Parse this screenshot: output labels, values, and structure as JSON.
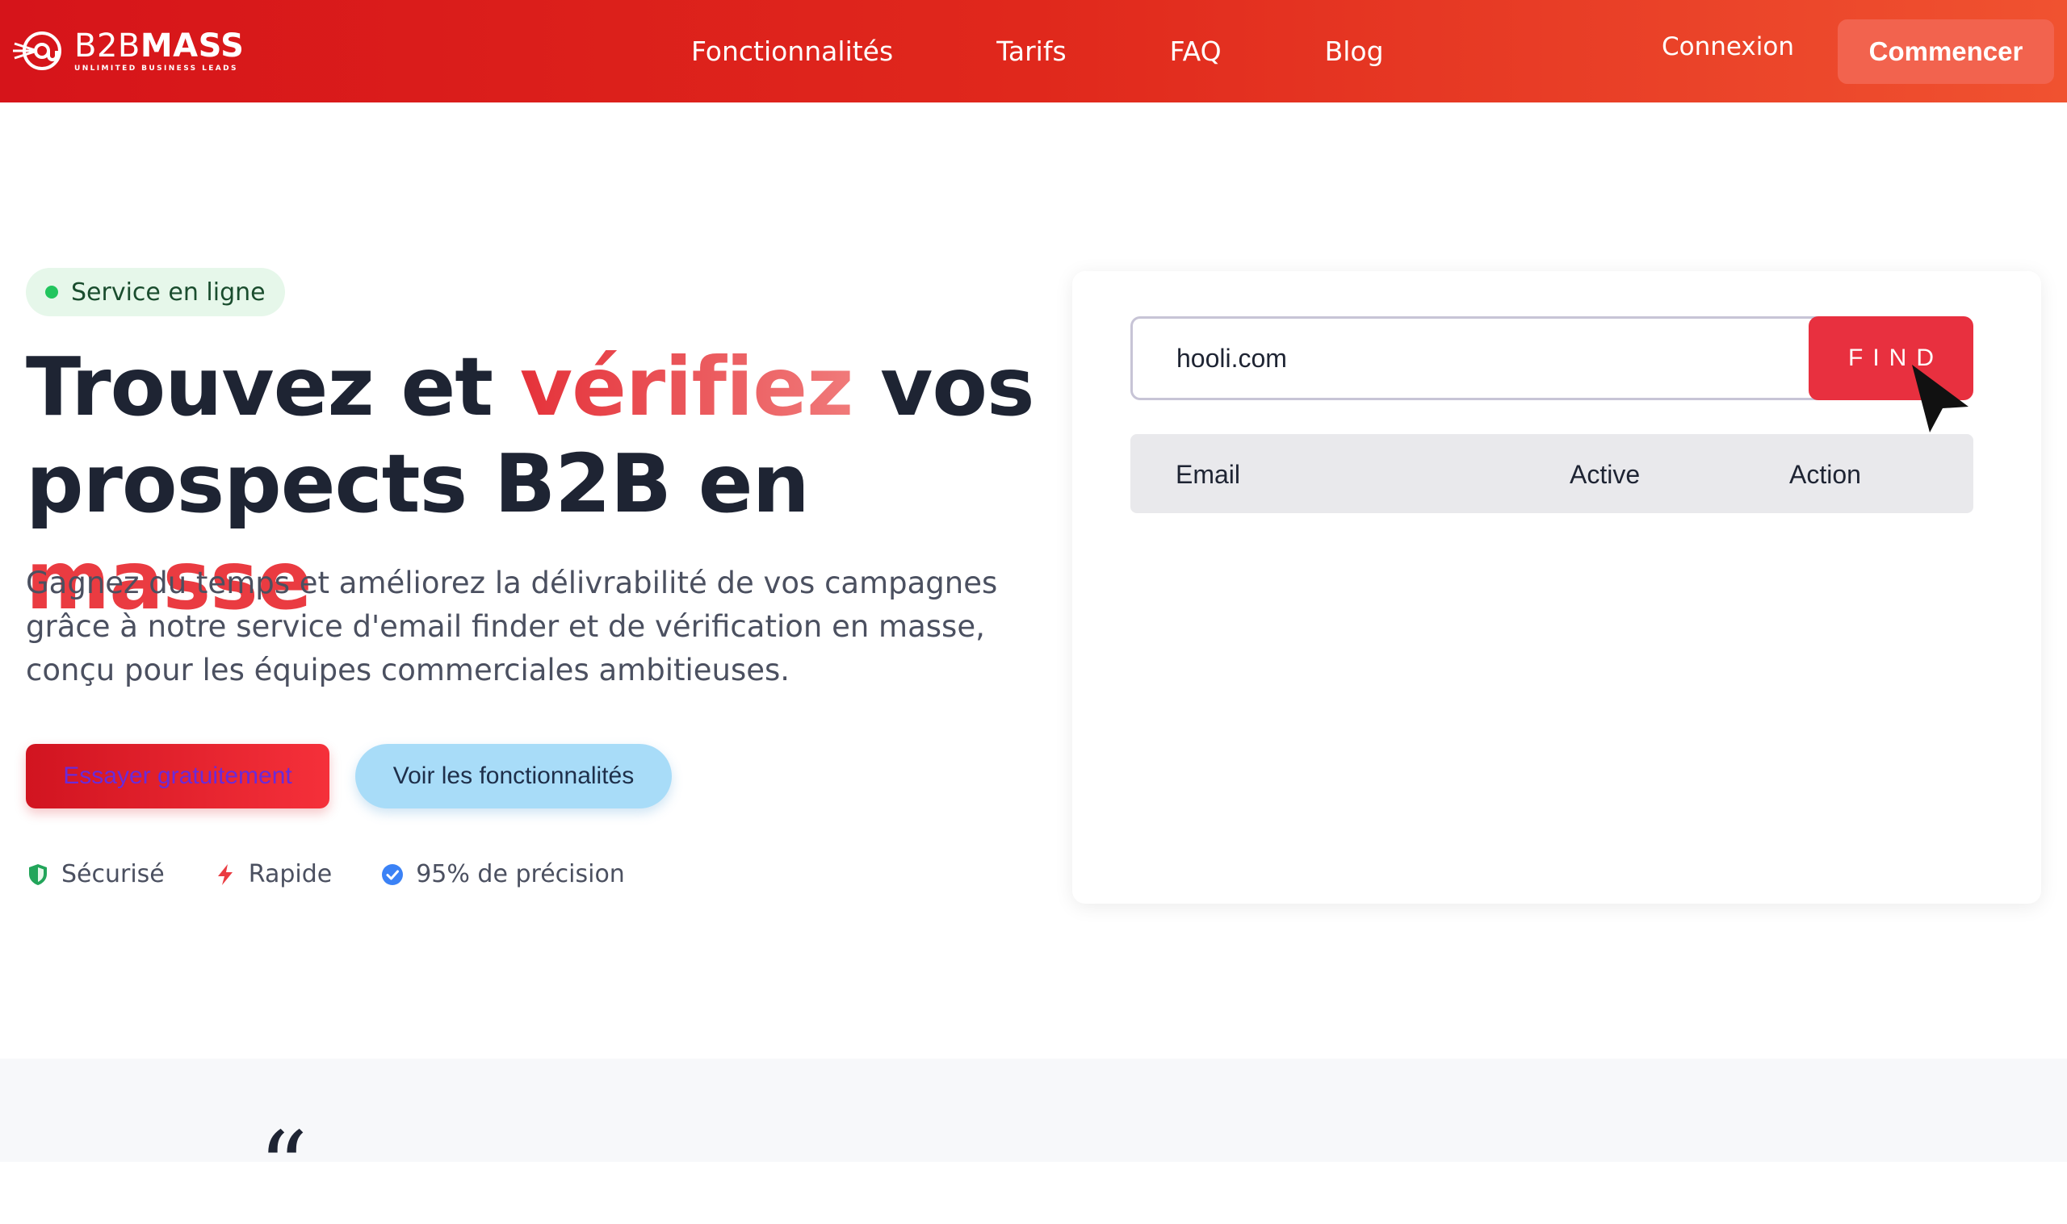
{
  "brand": {
    "name_part1": "B2B",
    "name_part2": "MASS",
    "tagline": "UNLIMITED BUSINESS LEADS"
  },
  "nav": {
    "links": [
      "Fonctionnalités",
      "Tarifs",
      "FAQ",
      "Blog"
    ],
    "login_label": "Connexion",
    "cta_label": "Commencer"
  },
  "hero": {
    "badge": "Service en ligne",
    "headline": {
      "part1": "Trouvez et ",
      "accent1": "vérifiez",
      "part2": " vos prospects B2B en ",
      "accent2": "masse"
    },
    "subtitle": "Gagnez du temps et améliorez la délivrabilité de vos campagnes grâce à notre service d'email finder et de vérification en masse, conçu pour les équipes commerciales ambitieuses.",
    "primary_cta": "Essayer gratuitement",
    "secondary_cta": "Voir les fonctionnalités",
    "features": [
      {
        "icon": "shield-icon",
        "label": "Sécurisé"
      },
      {
        "icon": "bolt-icon",
        "label": "Rapide"
      },
      {
        "icon": "check-circle-icon",
        "label": "95% de précision"
      }
    ]
  },
  "demo": {
    "search_value": "hooli.com",
    "find_label": "FIND",
    "columns": [
      "Email",
      "Active",
      "Action"
    ]
  },
  "colors": {
    "brand_red": "#e0281c",
    "accent_red": "#ea3b41",
    "cta_orange": "#f2634e",
    "secondary_blue": "#a8dcf8",
    "online_green": "#22c55e"
  },
  "testimonial": {
    "quote_mark": "“"
  }
}
